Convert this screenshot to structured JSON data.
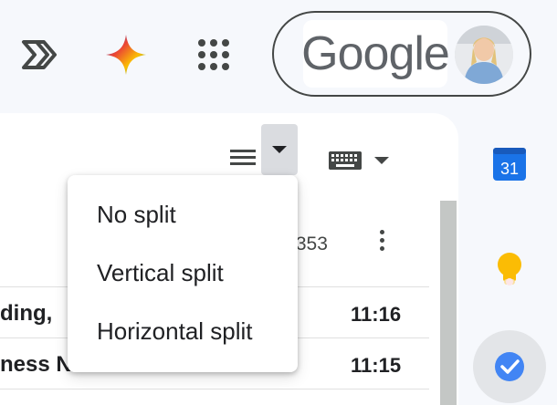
{
  "topbar": {
    "app_launcher_icon": "double-chevron-icon",
    "gemini_icon": "gemini-star-icon",
    "apps_icon": "apps-grid-icon",
    "logo_text": "Google",
    "avatar_icon": "profile-photo"
  },
  "toolbar": {
    "density_icon": "density-icon",
    "split_icon": "caret-down-icon",
    "keyboard_icon": "keyboard-icon"
  },
  "mail": {
    "count_fragment": ",353",
    "rows": [
      {
        "text": "ding, ",
        "time": "11:16"
      },
      {
        "text": "ness N…",
        "time": "11:15"
      }
    ]
  },
  "split_menu": {
    "items": [
      "No split",
      "Vertical split",
      "Horizontal split"
    ]
  },
  "side_panel": {
    "calendar_day": "31",
    "calendar_icon": "calendar-icon",
    "keep_icon": "keep-bulb-icon",
    "tasks_icon": "tasks-check-icon"
  },
  "colors": {
    "background": "#f6f8fc",
    "menu_bg": "#ffffff",
    "calendar_blue": "#1a73e8",
    "keep_yellow": "#fbbc04",
    "tasks_blue": "#4285f4"
  }
}
